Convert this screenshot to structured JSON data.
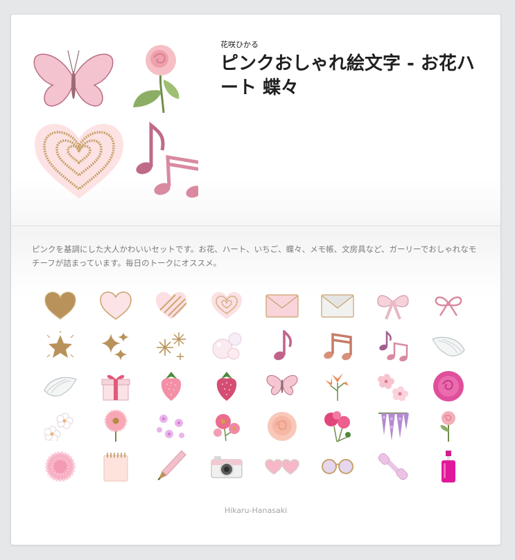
{
  "product": {
    "author": "花咲ひかる",
    "title": "ピンクおしゃれ絵文字 - お花ハート 蝶々",
    "description": "ピンクを基調にした大人かわいいセットです。お花、ハート、いちご、蝶々、メモ帳、文房具など、ガーリーでおしゃれなモチーフが詰まっています。毎日のトークにオススメ。",
    "copyright": "Hikaru-Hanasaki"
  },
  "header_art": [
    "butterfly-icon",
    "rose-icon",
    "glitter-heart-icon",
    "music-notes-icon"
  ],
  "emoji_grid": [
    "gold-glitter-heart-icon",
    "pink-heart-icon",
    "striped-heart-icon",
    "double-heart-icon",
    "pink-envelope-icon",
    "white-envelope-icon",
    "pink-bow-icon",
    "ribbon-bow-icon",
    "gold-star-icon",
    "sparkles-icon",
    "twinkle-stars-icon",
    "bubbles-icon",
    "music-note-icon",
    "beamed-notes-icon",
    "music-notes-icon",
    "white-wing-icon",
    "white-wing-left-icon",
    "gift-box-icon",
    "pink-strawberry-icon",
    "red-strawberry-icon",
    "butterfly-icon",
    "lily-flower-icon",
    "cherry-blossom-icon",
    "pink-rose-icon",
    "white-blossom-icon",
    "gerbera-icon",
    "sakura-flowers-icon",
    "cosmos-flower-icon",
    "peach-rose-icon",
    "pink-bouquet-icon",
    "wisteria-icon",
    "rose-stem-icon",
    "carnation-icon",
    "notepad-icon",
    "pen-icon",
    "camera-icon",
    "heart-sunglasses-icon",
    "round-glasses-icon",
    "dumbbell-icon",
    "pink-bottle-icon"
  ],
  "colors": {
    "pink": "#f3b8c6",
    "pink_dark": "#d9849a",
    "blush": "#fde2e4",
    "gold": "#b8925a",
    "magenta": "#e0189a",
    "grey": "#d9dadc"
  }
}
